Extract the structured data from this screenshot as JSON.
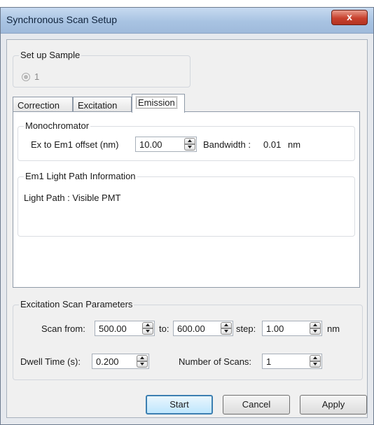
{
  "window": {
    "title": "Synchronous Scan Setup",
    "close_label": "x"
  },
  "sample_group": {
    "label": "Set up Sample",
    "radio_label": "1"
  },
  "tabs": [
    {
      "label": "Correction"
    },
    {
      "label": "Excitation"
    },
    {
      "label": "Emission"
    }
  ],
  "monochromator": {
    "label": "Monochromator",
    "offset_label": "Ex to Em1 offset (nm)",
    "offset_value": "10.00",
    "bandwidth_label": "Bandwidth :",
    "bandwidth_value": "0.01",
    "bandwidth_unit": "nm"
  },
  "light_path": {
    "label": "Em1 Light Path Information",
    "text": "Light Path :  Visible PMT"
  },
  "scan_params": {
    "label": "Excitation Scan Parameters",
    "scan_from_label": "Scan from:",
    "scan_from_value": "500.00",
    "to_label": "to:",
    "to_value": "600.00",
    "step_label": "step:",
    "step_value": "1.00",
    "step_unit": "nm",
    "dwell_label": "Dwell Time (s):",
    "dwell_value": "0.200",
    "num_scans_label": "Number of Scans:",
    "num_scans_value": "1"
  },
  "buttons": {
    "start": "Start",
    "cancel": "Cancel",
    "apply": "Apply"
  }
}
